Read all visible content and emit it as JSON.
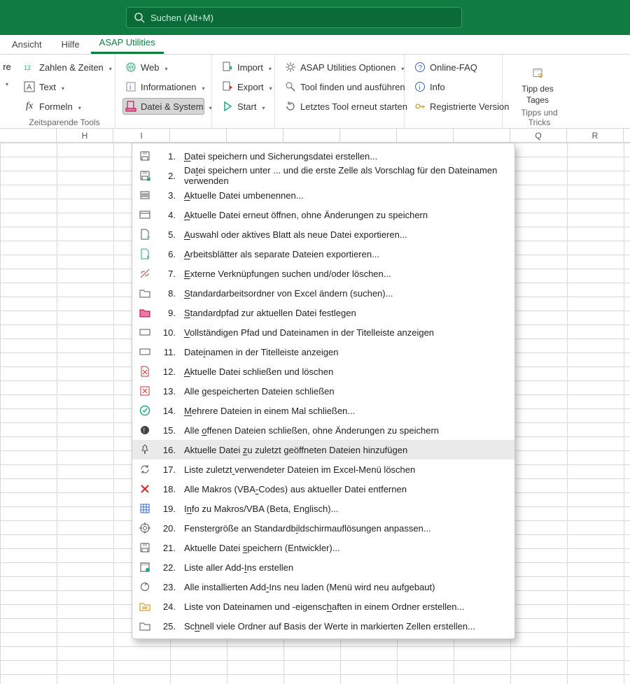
{
  "search": {
    "placeholder": "Suchen (Alt+M)"
  },
  "tabs": {
    "ansicht": "Ansicht",
    "hilfe": "Hilfe",
    "asap": "ASAP Utilities"
  },
  "ribbon": {
    "trim_label": "re",
    "g1": {
      "zahlen": "Zahlen & Zeiten",
      "text": "Text",
      "formeln": "Formeln",
      "label": "Zeitsparende Tools"
    },
    "g2": {
      "web": "Web",
      "info": "Informationen",
      "datei": "Datei & System"
    },
    "g3": {
      "import": "Import",
      "export": "Export",
      "start": "Start"
    },
    "g4": {
      "optionen": "ASAP Utilities Optionen",
      "finden": "Tool finden und ausführen",
      "letztes": "Letztes Tool erneut starten"
    },
    "g5": {
      "faq": "Online-FAQ",
      "info": "Info",
      "reg": "Registrierte Version"
    },
    "g6": {
      "tipp1": "Tipp des",
      "tipp2": "Tages",
      "label": "Tipps und Tricks"
    }
  },
  "columns": [
    "",
    "H",
    "I",
    "",
    "",
    "",
    "",
    "",
    "",
    "Q",
    "R"
  ],
  "menu": [
    {
      "n": "1.",
      "t": "Datei speichern und Sicherungsdatei erstellen...",
      "u": 0,
      "icon": "save"
    },
    {
      "n": "2.",
      "t": "Datei speichern unter ... und die erste Zelle als Vorschlag für den Dateinamen verwenden",
      "u": 2,
      "icon": "save-as"
    },
    {
      "n": "3.",
      "t": "Aktuelle Datei umbenennen...",
      "u": 0,
      "icon": "barcode"
    },
    {
      "n": "4.",
      "t": "Aktuelle Datei erneut öffnen, ohne Änderungen zu speichern",
      "u": 0,
      "icon": "window"
    },
    {
      "n": "5.",
      "t": "Auswahl oder aktives Blatt als neue Datei exportieren...",
      "u": 0,
      "icon": "doc-plus"
    },
    {
      "n": "6.",
      "t": "Arbeitsblätter als separate Dateien exportieren...",
      "u": 0,
      "icon": "doc-plus-green"
    },
    {
      "n": "7.",
      "t": "Externe Verknüpfungen suchen und/oder löschen...",
      "u": 0,
      "icon": "link-break"
    },
    {
      "n": "8.",
      "t": "Standardarbeitsordner von Excel ändern (suchen)...",
      "u": 0,
      "icon": "folder"
    },
    {
      "n": "9.",
      "t": "Standardpfad zur aktuellen Datei festlegen",
      "u": 0,
      "icon": "folder-fill"
    },
    {
      "n": "10.",
      "t": "Vollständigen Pfad und Dateinamen in der Titelleiste anzeigen",
      "u": 0,
      "icon": "rect"
    },
    {
      "n": "11.",
      "t": "Dateinamen in der Titelleiste anzeigen",
      "u": 4,
      "icon": "rect"
    },
    {
      "n": "12.",
      "t": "Aktuelle Datei schließen und löschen",
      "u": 0,
      "icon": "doc-x"
    },
    {
      "n": "13.",
      "t": "Alle gespeicherten Dateien schließen",
      "u": 5,
      "icon": "x-box"
    },
    {
      "n": "14.",
      "t": "Mehrere Dateien in einem Mal schließen...",
      "u": 0,
      "icon": "check-circle"
    },
    {
      "n": "15.",
      "t": "Alle offenen Dateien schließen, ohne Änderungen zu speichern",
      "u": 5,
      "icon": "dot-dark"
    },
    {
      "n": "16.",
      "t": "Aktuelle Datei zu zuletzt geöffneten Dateien hinzufügen",
      "u": 15,
      "icon": "pin",
      "hover": true
    },
    {
      "n": "17.",
      "t": "Liste zuletzt verwendeter Dateien im Excel-Menü löschen",
      "u": 13,
      "icon": "refresh"
    },
    {
      "n": "18.",
      "t": "Alle Makros (VBA-Codes) aus aktueller Datei entfernen",
      "u": 16,
      "icon": "x-red"
    },
    {
      "n": "19.",
      "t": "Info zu Makros/VBA (Beta, Englisch)...",
      "u": 1,
      "icon": "table"
    },
    {
      "n": "20.",
      "t": "Fenstergröße an Standardbildschirmauflösungen anpassen...",
      "u": 25,
      "icon": "target"
    },
    {
      "n": "21.",
      "t": "Aktuelle Datei speichern (Entwickler)...",
      "u": 15,
      "icon": "save"
    },
    {
      "n": "22.",
      "t": "Liste aller Add-Ins erstellen",
      "u": 16,
      "icon": "addin"
    },
    {
      "n": "23.",
      "t": "Alle installierten Add-Ins neu laden (Menü wird neu aufgebaut)",
      "u": 22,
      "icon": "reload"
    },
    {
      "n": "24.",
      "t": "Liste von Dateinamen und -eigenschaften in einem Ordner erstellen...",
      "u": 33,
      "icon": "folder-list"
    },
    {
      "n": "25.",
      "t": "Schnell viele Ordner auf Basis der Werte in markierten Zellen erstellen...",
      "u": 2,
      "icon": "folder"
    }
  ]
}
